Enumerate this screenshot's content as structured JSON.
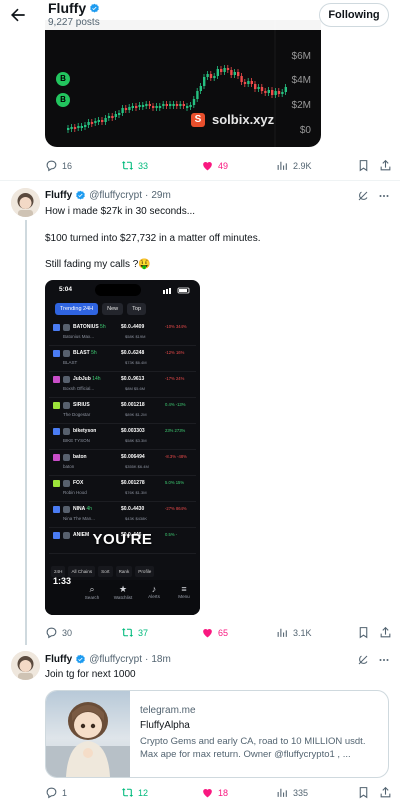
{
  "header": {
    "title": "Fluffy",
    "post_count": "9,227 posts",
    "follow_label": "Following"
  },
  "pinned_chart": {
    "y_labels": [
      "$6M",
      "$4M",
      "$2M",
      "$0"
    ],
    "badges": [
      "B",
      "B"
    ],
    "watermark_logo": "S",
    "watermark": "solbix.xyz"
  },
  "post1_actions": {
    "replies": "16",
    "reposts": "33",
    "likes": "49",
    "views": "2.9K"
  },
  "post2": {
    "name": "Fluffy",
    "handle": "@fluffycrypt",
    "time": "29m",
    "lines": [
      "How i made $27k in 30 seconds...",
      "$100 turned into $27,732 in a matter off minutes.",
      "Still fading my calls ?🤑"
    ],
    "actions": {
      "replies": "30",
      "reposts": "37",
      "likes": "65",
      "views": "3.1K"
    }
  },
  "phone": {
    "time": "5:04",
    "tabs": [
      "Trending 24H",
      "New",
      "Top"
    ],
    "rows": [
      {
        "sym": "BATONIUS",
        "age": "5h",
        "name": "Batonius Max...",
        "price": "$0.0₄4409",
        "stats": "$58K   $19M",
        "chg": "-10%  344%",
        "icolor": "#4a7cf4"
      },
      {
        "sym": "BLAST",
        "age": "5h",
        "name": "BLAST",
        "price": "$0.0₄6248",
        "stats": "$73K   $6.4M",
        "chg": "-12%  16%",
        "icolor": "#4a7cf4"
      },
      {
        "sym": "JubJub",
        "age": "14h",
        "name": "Boxsh Official...",
        "price": "$0.0₄9613",
        "stats": "$8M   $5.6M",
        "chg": "-17%  24%",
        "icolor": "#c94ec9"
      },
      {
        "sym": "SIRIUS",
        "age": "",
        "name": "The Dogestar",
        "price": "$0.001218",
        "stats": "$89K   $1.2M",
        "chg": "0.4%  -13%",
        "icolor": "#9be33a"
      },
      {
        "sym": "biketyson",
        "age": "",
        "name": "BIKE TYSON",
        "price": "$0.003303",
        "stats": "$58K   $3.3M",
        "chg": "23%  273%",
        "icolor": "#4a7cf4"
      },
      {
        "sym": "baton",
        "age": "",
        "name": "baton",
        "price": "$0.006494",
        "stats": "$355K   $6.4M",
        "chg": "-8.3%  -48%",
        "icolor": "#c94ec9"
      },
      {
        "sym": "FOX",
        "age": "",
        "name": "Robin Hood",
        "price": "$0.001278",
        "stats": "$76K   $1.3M",
        "chg": "5.0%  15%",
        "icolor": "#9be33a"
      },
      {
        "sym": "NINA",
        "age": "4h",
        "name": "Nina The Man...",
        "price": "$0.0₄4430",
        "stats": "$43K   $438K",
        "chg": "-27%  864%",
        "icolor": "#4a7cf4"
      },
      {
        "sym": "ANIEM",
        "age": "",
        "name": "",
        "price": "$0.0₄446",
        "stats": "",
        "chg": "0.5%  -",
        "icolor": "#4a7cf4"
      }
    ],
    "caption": "YOU'RE",
    "toolbar": [
      "24H",
      "All Chains",
      "Sort",
      "Rank",
      "Profile"
    ],
    "timer": "1:33",
    "nav": [
      "Search",
      "Watchlist",
      "Alerts",
      "Menu"
    ]
  },
  "post3": {
    "name": "Fluffy",
    "handle": "@fluffycrypt",
    "time": "18m",
    "text": "Join tg for next 1000",
    "card": {
      "domain": "telegram.me",
      "title": "FluffyAlpha",
      "description": "Crypto Gems and early CA, road to 10 MILLION usdt. Max ape for max return. Owner @fluffycrypto1 , ..."
    },
    "actions": {
      "replies": "1",
      "reposts": "12",
      "likes": "18",
      "views": "335"
    }
  },
  "colors": {
    "like": "#f91880",
    "repost": "#00ba7c",
    "verified": "#1d9bf0",
    "muted": "#536471"
  },
  "icons": [
    "back-arrow-icon",
    "verified-icon",
    "reply-icon",
    "repost-icon",
    "heart-icon",
    "views-icon",
    "bookmark-icon",
    "share-icon",
    "grok-icon",
    "more-icon"
  ]
}
